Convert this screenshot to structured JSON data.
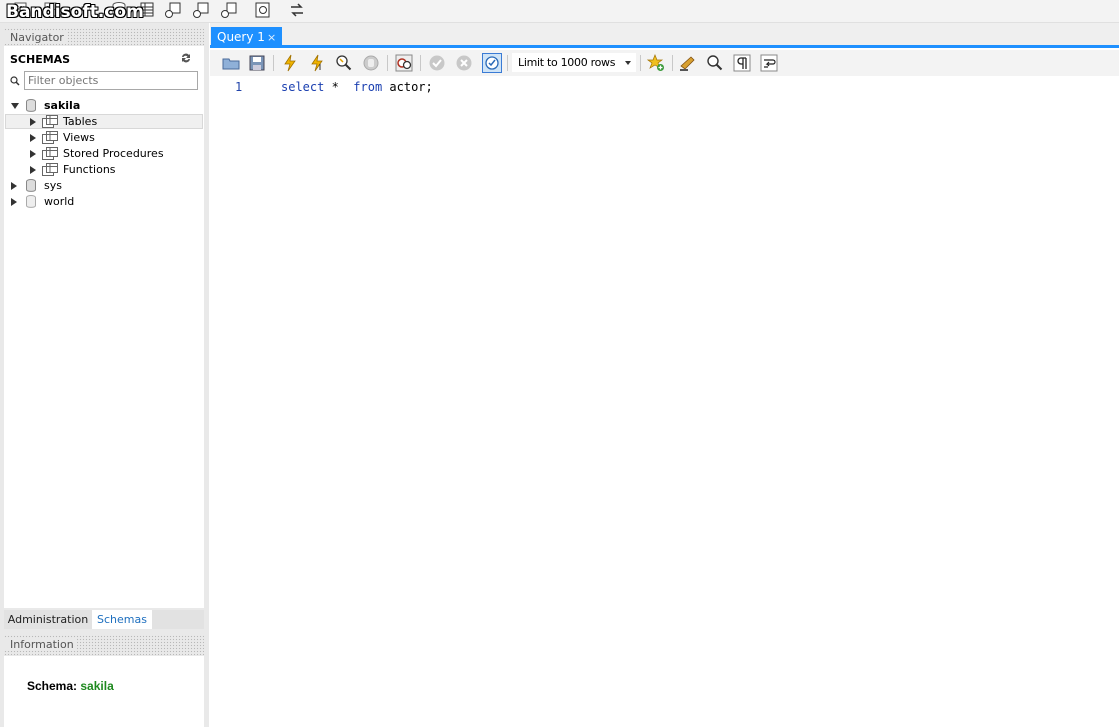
{
  "watermark": "Bandisoft.com",
  "navigator": {
    "header": "Navigator",
    "schemas_title": "SCHEMAS",
    "filter_placeholder": "Filter objects",
    "tree": {
      "sakila": "sakila",
      "tables": "Tables",
      "views": "Views",
      "stored_procedures": "Stored Procedures",
      "functions": "Functions",
      "sys": "sys",
      "world": "world"
    }
  },
  "bottom_tabs": {
    "administration": "Administration",
    "schemas": "Schemas"
  },
  "information": {
    "header": "Information",
    "schema_label": "Schema:",
    "schema_value": "sakila"
  },
  "editor": {
    "tab_label": "Query 1",
    "tab_close": "×",
    "limit_select": "Limit to 1000 rows",
    "line_number": "1",
    "code": {
      "kw_select": "select",
      "star": " * ",
      "kw_from": "from",
      "rest": " actor;"
    }
  },
  "colors": {
    "accent": "#1e90ff",
    "schema_value": "#1f8a1f"
  }
}
